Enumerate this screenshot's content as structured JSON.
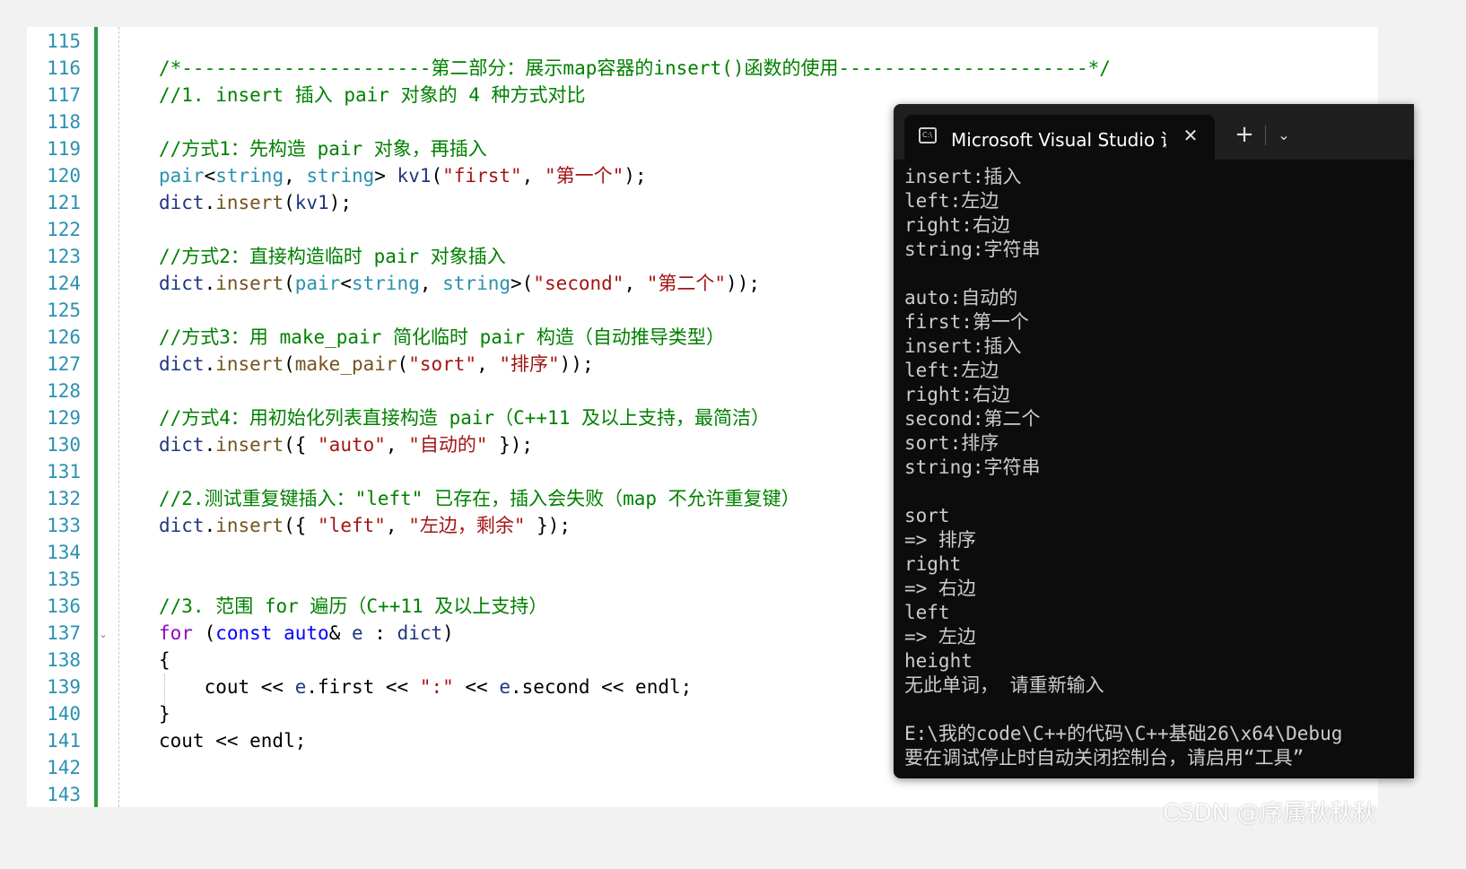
{
  "editor": {
    "line_numbers": [
      "115",
      "116",
      "117",
      "118",
      "119",
      "120",
      "121",
      "122",
      "123",
      "124",
      "125",
      "126",
      "127",
      "128",
      "129",
      "130",
      "131",
      "132",
      "133",
      "134",
      "135",
      "136",
      "137",
      "138",
      "139",
      "140",
      "141",
      "142",
      "143"
    ],
    "lines": [
      [],
      [
        {
          "t": "/*----------------------第二部分：展示map容器的insert()函数的使用----------------------*/",
          "c": "comment"
        }
      ],
      [
        {
          "t": "//1. insert 插入 pair 对象的 4 种方式对比",
          "c": "comment"
        }
      ],
      [],
      [
        {
          "t": "//方式1：先构造 pair 对象，再插入",
          "c": "comment"
        }
      ],
      [
        {
          "t": "pair",
          "c": "type"
        },
        {
          "t": "<",
          "c": "plain"
        },
        {
          "t": "string",
          "c": "type"
        },
        {
          "t": ", ",
          "c": "plain"
        },
        {
          "t": "string",
          "c": "type"
        },
        {
          "t": "> ",
          "c": "plain"
        },
        {
          "t": "kv1",
          "c": "var"
        },
        {
          "t": "(",
          "c": "plain"
        },
        {
          "t": "\"first\"",
          "c": "string"
        },
        {
          "t": ", ",
          "c": "plain"
        },
        {
          "t": "\"第一个\"",
          "c": "string"
        },
        {
          "t": ");",
          "c": "plain"
        }
      ],
      [
        {
          "t": "dict",
          "c": "var"
        },
        {
          "t": ".",
          "c": "plain"
        },
        {
          "t": "insert",
          "c": "func"
        },
        {
          "t": "(",
          "c": "plain"
        },
        {
          "t": "kv1",
          "c": "var"
        },
        {
          "t": ");",
          "c": "plain"
        }
      ],
      [],
      [
        {
          "t": "//方式2：直接构造临时 pair 对象插入",
          "c": "comment"
        }
      ],
      [
        {
          "t": "dict",
          "c": "var"
        },
        {
          "t": ".",
          "c": "plain"
        },
        {
          "t": "insert",
          "c": "func"
        },
        {
          "t": "(",
          "c": "plain"
        },
        {
          "t": "pair",
          "c": "type"
        },
        {
          "t": "<",
          "c": "plain"
        },
        {
          "t": "string",
          "c": "type"
        },
        {
          "t": ", ",
          "c": "plain"
        },
        {
          "t": "string",
          "c": "type"
        },
        {
          "t": ">(",
          "c": "plain"
        },
        {
          "t": "\"second\"",
          "c": "string"
        },
        {
          "t": ", ",
          "c": "plain"
        },
        {
          "t": "\"第二个\"",
          "c": "string"
        },
        {
          "t": "));",
          "c": "plain"
        }
      ],
      [],
      [
        {
          "t": "//方式3：用 make_pair 简化临时 pair 构造（自动推导类型）",
          "c": "comment"
        }
      ],
      [
        {
          "t": "dict",
          "c": "var"
        },
        {
          "t": ".",
          "c": "plain"
        },
        {
          "t": "insert",
          "c": "func"
        },
        {
          "t": "(",
          "c": "plain"
        },
        {
          "t": "make_pair",
          "c": "func"
        },
        {
          "t": "(",
          "c": "plain"
        },
        {
          "t": "\"sort\"",
          "c": "string"
        },
        {
          "t": ", ",
          "c": "plain"
        },
        {
          "t": "\"排序\"",
          "c": "string"
        },
        {
          "t": "));",
          "c": "plain"
        }
      ],
      [],
      [
        {
          "t": "//方式4：用初始化列表直接构造 pair（C++11 及以上支持，最简洁）",
          "c": "comment"
        }
      ],
      [
        {
          "t": "dict",
          "c": "var"
        },
        {
          "t": ".",
          "c": "plain"
        },
        {
          "t": "insert",
          "c": "func"
        },
        {
          "t": "({ ",
          "c": "plain"
        },
        {
          "t": "\"auto\"",
          "c": "string"
        },
        {
          "t": ", ",
          "c": "plain"
        },
        {
          "t": "\"自动的\"",
          "c": "string"
        },
        {
          "t": " });",
          "c": "plain"
        }
      ],
      [],
      [
        {
          "t": "//2.测试重复键插入：\"left\" 已存在，插入会失败（map 不允许重复键）",
          "c": "comment"
        }
      ],
      [
        {
          "t": "dict",
          "c": "var"
        },
        {
          "t": ".",
          "c": "plain"
        },
        {
          "t": "insert",
          "c": "func"
        },
        {
          "t": "({ ",
          "c": "plain"
        },
        {
          "t": "\"left\"",
          "c": "string"
        },
        {
          "t": ", ",
          "c": "plain"
        },
        {
          "t": "\"左边，剩余\"",
          "c": "string"
        },
        {
          "t": " });",
          "c": "plain"
        }
      ],
      [],
      [],
      [
        {
          "t": "//3. 范围 for 遍历（C++11 及以上支持）",
          "c": "comment"
        }
      ],
      [
        {
          "t": "for",
          "c": "control"
        },
        {
          "t": " (",
          "c": "plain"
        },
        {
          "t": "const",
          "c": "keyword"
        },
        {
          "t": " ",
          "c": "plain"
        },
        {
          "t": "auto",
          "c": "keyword"
        },
        {
          "t": "& ",
          "c": "plain"
        },
        {
          "t": "e",
          "c": "var"
        },
        {
          "t": " : ",
          "c": "plain"
        },
        {
          "t": "dict",
          "c": "var"
        },
        {
          "t": ")",
          "c": "plain"
        }
      ],
      [
        {
          "t": "{",
          "c": "plain"
        }
      ],
      [
        {
          "t": "    cout << ",
          "c": "plain"
        },
        {
          "t": "e",
          "c": "var"
        },
        {
          "t": ".first << ",
          "c": "plain"
        },
        {
          "t": "\":\"",
          "c": "string"
        },
        {
          "t": " << ",
          "c": "plain"
        },
        {
          "t": "e",
          "c": "var"
        },
        {
          "t": ".second << endl;",
          "c": "plain"
        }
      ],
      [
        {
          "t": "}",
          "c": "plain"
        }
      ],
      [
        {
          "t": "cout << endl;",
          "c": "plain"
        }
      ],
      [],
      []
    ]
  },
  "console": {
    "tab_title": "Microsoft Visual Studio 调试控制台",
    "tab_icon_text": "C:\\",
    "close_glyph": "✕",
    "new_tab_glyph": "+",
    "dropdown_glyph": "⌄",
    "output_lines": [
      "insert:插入",
      "left:左边",
      "right:右边",
      "string:字符串",
      "",
      "auto:自动的",
      "first:第一个",
      "insert:插入",
      "left:左边",
      "right:右边",
      "second:第二个",
      "sort:排序",
      "string:字符串",
      "",
      "sort",
      "=> 排序",
      "right",
      "=> 右边",
      "left",
      "=> 左边",
      "height",
      "无此单词， 请重新输入",
      "",
      "E:\\我的code\\C++的代码\\C++基础26\\x64\\Debug",
      "要在调试停止时自动关闭控制台，请启用“工具”"
    ]
  },
  "watermark": "CSDN @序属秋秋秋",
  "colors": {
    "comment": "#008000",
    "string": "#a31515",
    "keyword": "#0000ff",
    "control": "#8f08c4",
    "variable": "#1f377f",
    "type": "#2b91af",
    "function": "#74531f",
    "line_number": "#2b91af",
    "change_bar": "#2e9a48",
    "console_bg": "#0c0c0c",
    "console_text": "#cccccc"
  }
}
